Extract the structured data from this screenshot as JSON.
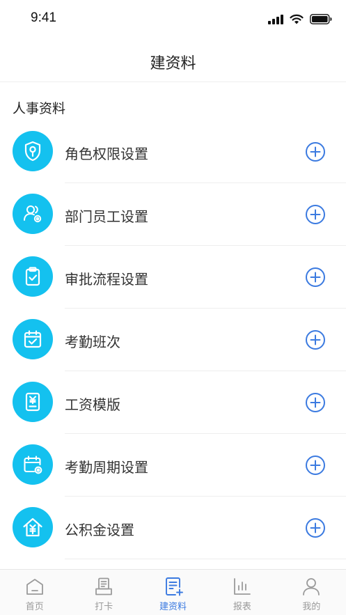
{
  "status": {
    "time": "9:41"
  },
  "nav": {
    "title": "建资料"
  },
  "section": {
    "title": "人事资料"
  },
  "items": [
    {
      "label": "角色权限设置",
      "icon": "shield-key-icon"
    },
    {
      "label": "部门员工设置",
      "icon": "users-gear-icon"
    },
    {
      "label": "审批流程设置",
      "icon": "clipboard-check-icon"
    },
    {
      "label": "考勤班次",
      "icon": "calendar-check-icon"
    },
    {
      "label": "工资模版",
      "icon": "salary-document-icon"
    },
    {
      "label": "考勤周期设置",
      "icon": "calendar-gear-icon"
    },
    {
      "label": "公积金设置",
      "icon": "house-yen-icon"
    }
  ],
  "tabs": [
    {
      "label": "首页",
      "icon": "home-icon"
    },
    {
      "label": "打卡",
      "icon": "punch-card-icon"
    },
    {
      "label": "建资料",
      "icon": "create-document-icon",
      "active": true
    },
    {
      "label": "报表",
      "icon": "bar-chart-icon"
    },
    {
      "label": "我的",
      "icon": "profile-icon"
    }
  ],
  "colors": {
    "accent": "#14c1ef",
    "tab_active": "#3b7ae0",
    "add_icon": "#3b7ae0"
  }
}
